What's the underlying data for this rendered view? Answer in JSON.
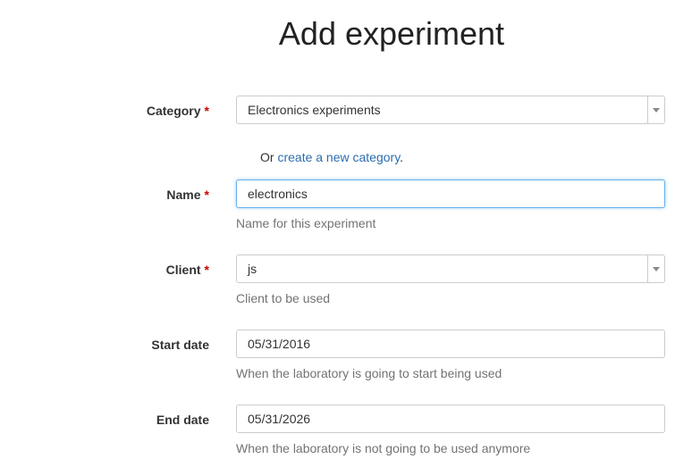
{
  "page": {
    "title": "Add experiment"
  },
  "form": {
    "required_marker": "*",
    "category": {
      "label": "Category",
      "value": "Electronics experiments",
      "or_prefix": "Or",
      "create_link": "create a new category",
      "or_suffix": "."
    },
    "name": {
      "label": "Name",
      "value": "electronics",
      "help": "Name for this experiment"
    },
    "client": {
      "label": "Client",
      "value": "js",
      "help": "Client to be used"
    },
    "start_date": {
      "label": "Start date",
      "value": "05/31/2016",
      "help": "When the laboratory is going to start being used"
    },
    "end_date": {
      "label": "End date",
      "value": "05/31/2026",
      "help": "When the laboratory is not going to be used anymore"
    }
  },
  "icons": {
    "select_arrow": "caret-down-icon"
  },
  "colors": {
    "required": "#cc0000",
    "link": "#2a6db0",
    "focus_border": "#66afe9",
    "help_text": "#737373"
  }
}
